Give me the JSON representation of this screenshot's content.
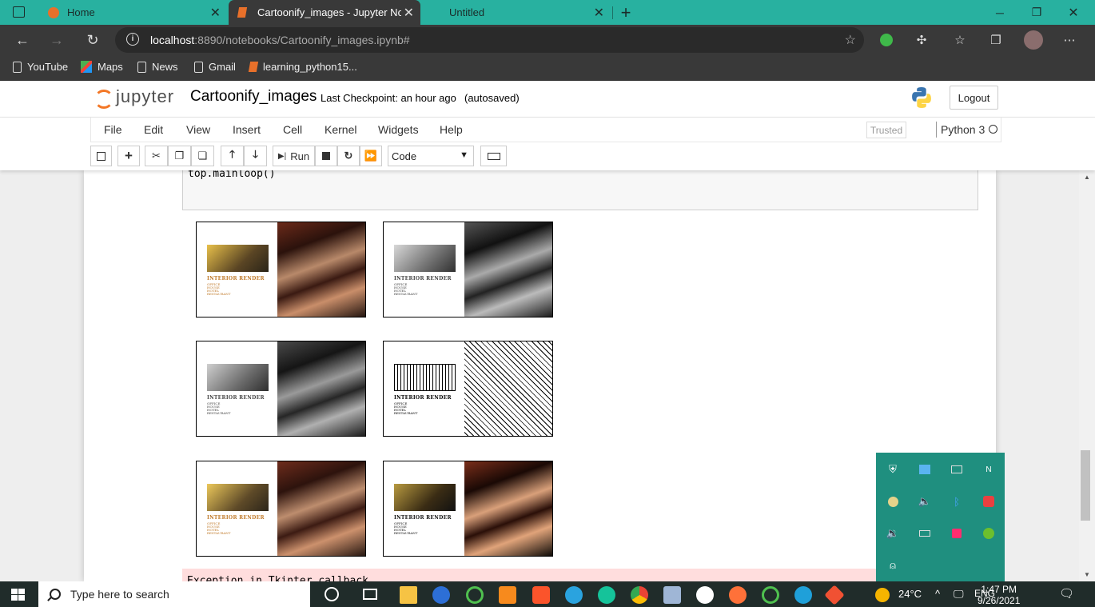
{
  "browser": {
    "tabs": [
      {
        "label": "Home",
        "close": "✕"
      },
      {
        "label": "Cartoonify_images - Jupyter Not",
        "close": "✕"
      },
      {
        "label": "Untitled",
        "close": "✕"
      }
    ],
    "new_tab": "+",
    "window_controls": {
      "minimize": "─",
      "maximize": "❐",
      "close": "✕"
    },
    "nav": {
      "back": "←",
      "forward": "→",
      "reload": "↻"
    },
    "url_host": "localhost",
    "url_rest": ":8890/notebooks/Cartoonify_images.ipynb#",
    "bookmarks": [
      "YouTube",
      "Maps",
      "News",
      "Gmail",
      "learning_python15..."
    ],
    "accent": "#28b1a0"
  },
  "jupyter": {
    "logo_text": "jupyter",
    "notebook_name": "Cartoonify_images",
    "checkpoint": "Last Checkpoint: an hour ago",
    "autosaved": "(autosaved)",
    "logout": "Logout",
    "menu": [
      "File",
      "Edit",
      "View",
      "Insert",
      "Cell",
      "Kernel",
      "Widgets",
      "Help"
    ],
    "trusted": "Trusted",
    "kernel": "Python 3",
    "toolbar": {
      "run": "Run",
      "cell_type": "Code"
    }
  },
  "notebook": {
    "code_line": "top.mainloop()",
    "error_line": "Exception in Tkinter callback",
    "output_images": [
      {
        "title": "INTERIOR RENDER",
        "lines": [
          "OFFICE",
          "HOUSE",
          "HOTEL",
          "RESTAURANT"
        ],
        "style": "color"
      },
      {
        "title": "INTERIOR RENDER",
        "lines": [
          "OFFICE",
          "HOUSE",
          "HOTEL",
          "RESTAURANT"
        ],
        "style": "gray"
      },
      {
        "title": "INTERIOR RENDER",
        "lines": [
          "OFFICE",
          "HOUSE",
          "HOTEL",
          "RESTAURANT"
        ],
        "style": "gray-smooth"
      },
      {
        "title": "INTERIOR RENDER",
        "lines": [
          "OFFICE",
          "HOUSE",
          "HOTEL",
          "RESTAURANT"
        ],
        "style": "edges"
      },
      {
        "title": "INTERIOR RENDER",
        "lines": [
          "OFFICE",
          "HOUSE",
          "HOTEL",
          "RESTAURANT"
        ],
        "style": "color-smooth"
      },
      {
        "title": "INTERIOR RENDER",
        "lines": [
          "OFFICE",
          "HOUSE",
          "HOTEL",
          "RESTAURANT"
        ],
        "style": "cartoon"
      }
    ]
  },
  "taskbar": {
    "search_placeholder": "Type here to search",
    "weather": "24°C",
    "language": "ENG",
    "time": "1:47 PM",
    "date": "9/26/2021"
  }
}
